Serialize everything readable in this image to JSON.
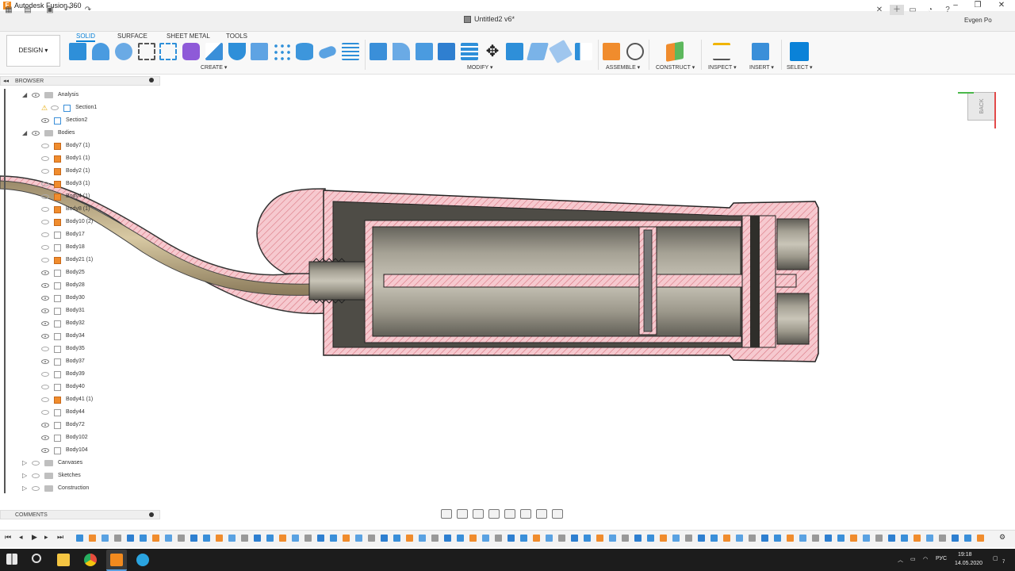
{
  "app": {
    "title": "Autodesk Fusion 360",
    "document": "Untitled2 v6*",
    "user": "Evgen Po"
  },
  "window_controls": {
    "minimize": "–",
    "maximize": "❐",
    "close": "✕"
  },
  "workspace": {
    "label": "DESIGN ▾"
  },
  "ribbon_tabs": [
    "SOLID",
    "SURFACE",
    "SHEET METAL",
    "TOOLS"
  ],
  "ribbon_groups": {
    "create": "CREATE ▾",
    "modify": "MODIFY ▾",
    "assemble": "ASSEMBLE ▾",
    "construct": "CONSTRUCT ▾",
    "inspect": "INSPECT ▾",
    "insert": "INSERT ▾",
    "select": "SELECT ▾"
  },
  "browser": {
    "title": "BROWSER",
    "items": [
      {
        "label": "Analysis",
        "type": "folder",
        "indent": 1,
        "expanded": true,
        "visible": true
      },
      {
        "label": "Section1",
        "type": "section",
        "indent": 2,
        "warning": true,
        "visible": false
      },
      {
        "label": "Section2",
        "type": "section",
        "indent": 2,
        "visible": true
      },
      {
        "label": "Bodies",
        "type": "folder",
        "indent": 1,
        "expanded": true,
        "visible": true
      },
      {
        "label": "Body7 (1)",
        "type": "body",
        "orange": true,
        "visible": false
      },
      {
        "label": "Body1 (1)",
        "type": "body",
        "orange": true,
        "visible": false
      },
      {
        "label": "Body2 (1)",
        "type": "body",
        "orange": true,
        "visible": false
      },
      {
        "label": "Body3 (1)",
        "type": "body",
        "orange": true,
        "visible": false
      },
      {
        "label": "Body4 (1)",
        "type": "body",
        "orange": true,
        "visible": false
      },
      {
        "label": "Body8 (1)",
        "type": "body",
        "orange": true,
        "visible": false
      },
      {
        "label": "Body10 (2)",
        "type": "body",
        "orange": true,
        "visible": false
      },
      {
        "label": "Body17",
        "type": "body",
        "visible": false
      },
      {
        "label": "Body18",
        "type": "body",
        "visible": false
      },
      {
        "label": "Body21 (1)",
        "type": "body",
        "orange": true,
        "visible": false
      },
      {
        "label": "Body25",
        "type": "body",
        "visible": true
      },
      {
        "label": "Body28",
        "type": "body",
        "visible": true
      },
      {
        "label": "Body30",
        "type": "body",
        "visible": true
      },
      {
        "label": "Body31",
        "type": "body",
        "visible": true
      },
      {
        "label": "Body32",
        "type": "body",
        "visible": true
      },
      {
        "label": "Body34",
        "type": "body",
        "visible": true
      },
      {
        "label": "Body35",
        "type": "body",
        "visible": false
      },
      {
        "label": "Body37",
        "type": "body",
        "visible": true
      },
      {
        "label": "Body39",
        "type": "body",
        "visible": false
      },
      {
        "label": "Body40",
        "type": "body",
        "visible": false
      },
      {
        "label": "Body41 (1)",
        "type": "body",
        "orange": true,
        "visible": false
      },
      {
        "label": "Body44",
        "type": "body",
        "visible": false
      },
      {
        "label": "Body72",
        "type": "body",
        "visible": true
      },
      {
        "label": "Body102",
        "type": "body",
        "visible": true
      },
      {
        "label": "Body104",
        "type": "body",
        "visible": true
      },
      {
        "label": "Canvases",
        "type": "folder",
        "indent": 1,
        "expanded": false,
        "visible": false
      },
      {
        "label": "Sketches",
        "type": "folder",
        "indent": 1,
        "expanded": false,
        "visible": false
      },
      {
        "label": "Construction",
        "type": "folder",
        "indent": 1,
        "expanded": false,
        "visible": false
      }
    ]
  },
  "comments": {
    "title": "COMMENTS"
  },
  "viewcube": {
    "face": "BACK"
  },
  "taskbar": {
    "lang": "РУС",
    "time": "19:18",
    "date": "14.05.2020",
    "notif": "7"
  },
  "colors": {
    "accent": "#0a82d8",
    "section_fill": "#f6c9cf",
    "hatch": "#d9747f",
    "steel": "#8e8a7e",
    "orange": "#f08c2d"
  }
}
